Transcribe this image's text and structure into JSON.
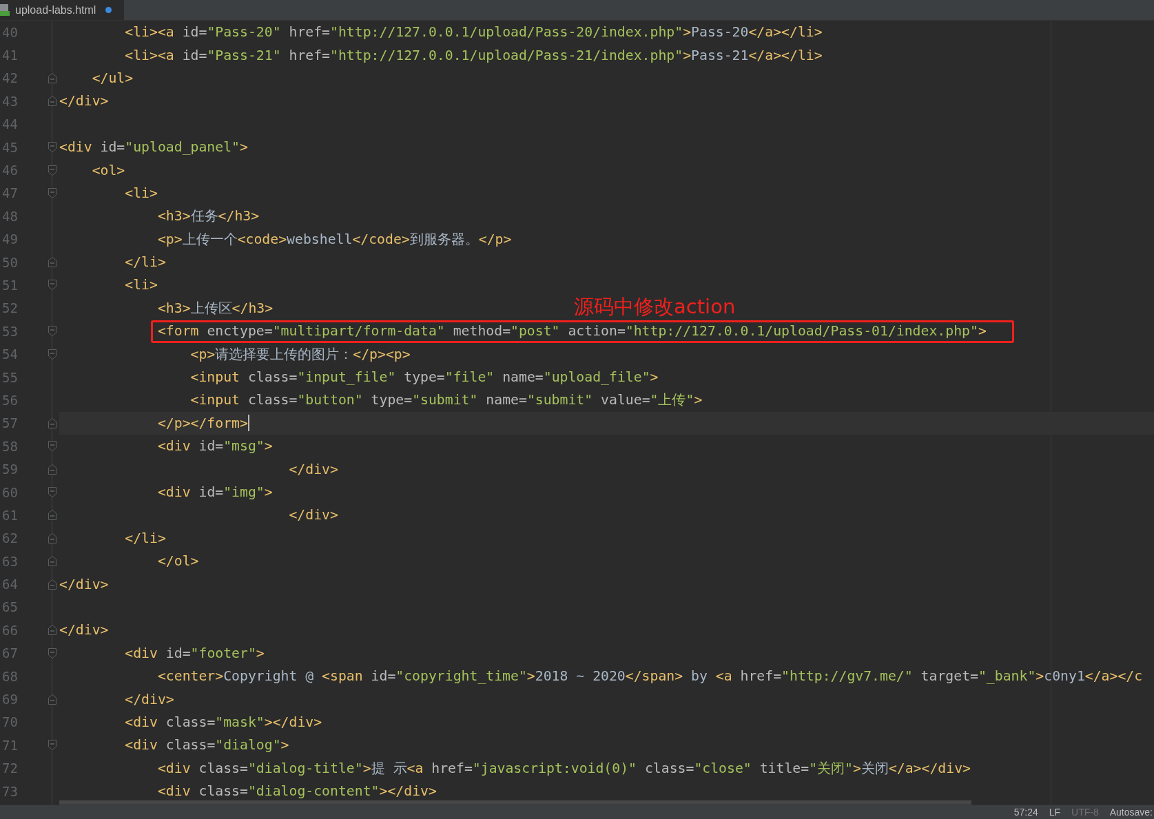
{
  "tab": {
    "label": "upload-labs.html",
    "modified": true,
    "selected": true
  },
  "lines": [
    {
      "number": "40",
      "kind": "plain",
      "segments": [
        {
          "kind": "tag",
          "text": "        <li><a"
        },
        {
          "kind": "attr",
          "text": " id="
        },
        {
          "kind": "value",
          "text": "\"Pass-20\""
        },
        {
          "kind": "attr",
          "text": " href="
        },
        {
          "kind": "value",
          "text": "\"http://127.0.0.1/upload/Pass-20/index.php\""
        },
        {
          "kind": "tag",
          "text": ">"
        },
        {
          "kind": "text",
          "text": "Pass-20"
        },
        {
          "kind": "tag",
          "text": "</a></li>"
        }
      ]
    },
    {
      "number": "41",
      "kind": "plain",
      "segments": [
        {
          "kind": "tag",
          "text": "        <li><a"
        },
        {
          "kind": "attr",
          "text": " id="
        },
        {
          "kind": "value",
          "text": "\"Pass-21\""
        },
        {
          "kind": "attr",
          "text": " href="
        },
        {
          "kind": "value",
          "text": "\"http://127.0.0.1/upload/Pass-21/index.php\""
        },
        {
          "kind": "tag",
          "text": ">"
        },
        {
          "kind": "text",
          "text": "Pass-21"
        },
        {
          "kind": "tag",
          "text": "</a></li>"
        }
      ]
    },
    {
      "number": "42",
      "kind": "fold-end",
      "segments": [
        {
          "kind": "tag",
          "text": "    </ul>"
        }
      ]
    },
    {
      "number": "43",
      "kind": "fold-end",
      "segments": [
        {
          "kind": "tag",
          "text": "</div>"
        }
      ]
    },
    {
      "number": "44",
      "kind": "plain"
    },
    {
      "number": "45",
      "kind": "fold-start",
      "segments": [
        {
          "kind": "tag",
          "text": "<div"
        },
        {
          "kind": "attr",
          "text": " id="
        },
        {
          "kind": "value",
          "text": "\"upload_panel\""
        },
        {
          "kind": "tag",
          "text": ">"
        }
      ]
    },
    {
      "number": "46",
      "kind": "fold-start",
      "segments": [
        {
          "kind": "tag",
          "text": "    <ol>"
        }
      ]
    },
    {
      "number": "47",
      "kind": "fold-start",
      "segments": [
        {
          "kind": "tag",
          "text": "        <li>"
        }
      ]
    },
    {
      "number": "48",
      "kind": "plain",
      "segments": [
        {
          "kind": "tag",
          "text": "            <h3>"
        },
        {
          "kind": "text",
          "text": "任务"
        },
        {
          "kind": "tag",
          "text": "</h3>"
        }
      ]
    },
    {
      "number": "49",
      "kind": "plain",
      "segments": [
        {
          "kind": "tag",
          "text": "            <p>"
        },
        {
          "kind": "text",
          "text": "上传一个"
        },
        {
          "kind": "tag",
          "text": "<code>"
        },
        {
          "kind": "text",
          "text": "webshell"
        },
        {
          "kind": "tag",
          "text": "</code>"
        },
        {
          "kind": "text",
          "text": "到服务器。"
        },
        {
          "kind": "tag",
          "text": "</p>"
        }
      ]
    },
    {
      "number": "50",
      "kind": "fold-end",
      "segments": [
        {
          "kind": "tag",
          "text": "        </li>"
        }
      ]
    },
    {
      "number": "51",
      "kind": "fold-start",
      "segments": [
        {
          "kind": "tag",
          "text": "        <li>"
        }
      ]
    },
    {
      "number": "52",
      "kind": "plain",
      "segments": [
        {
          "kind": "tag",
          "text": "            <h3>"
        },
        {
          "kind": "text",
          "text": "上传区"
        },
        {
          "kind": "tag",
          "text": "</h3>"
        }
      ]
    },
    {
      "number": "53",
      "kind": "fold-start",
      "boxed": true,
      "annotation": "源码中修改action",
      "segments": [
        {
          "kind": "tag",
          "text": "            <form"
        },
        {
          "kind": "attr",
          "text": " enctype="
        },
        {
          "kind": "value",
          "text": "\"multipart/form-data\""
        },
        {
          "kind": "attr",
          "text": " method="
        },
        {
          "kind": "value",
          "text": "\"post\""
        },
        {
          "kind": "attr",
          "text": " action="
        },
        {
          "kind": "value",
          "text": "\"http://127.0.0.1/upload/Pass-01/index.php\""
        },
        {
          "kind": "tag",
          "text": ">"
        }
      ]
    },
    {
      "number": "54",
      "kind": "fold-start",
      "segments": [
        {
          "kind": "tag",
          "text": "                <p>"
        },
        {
          "kind": "text",
          "text": "请选择要上传的图片："
        },
        {
          "kind": "tag",
          "text": "</p><p>"
        }
      ]
    },
    {
      "number": "55",
      "kind": "plain",
      "segments": [
        {
          "kind": "tag",
          "text": "                <input"
        },
        {
          "kind": "attr",
          "text": " class="
        },
        {
          "kind": "value",
          "text": "\"input_file\""
        },
        {
          "kind": "attr",
          "text": " type="
        },
        {
          "kind": "value",
          "text": "\"file\""
        },
        {
          "kind": "attr",
          "text": " name="
        },
        {
          "kind": "value",
          "text": "\"upload_file\""
        },
        {
          "kind": "tag",
          "text": ">"
        }
      ]
    },
    {
      "number": "56",
      "kind": "plain",
      "segments": [
        {
          "kind": "tag",
          "text": "                <input"
        },
        {
          "kind": "attr",
          "text": " class="
        },
        {
          "kind": "value",
          "text": "\"button\""
        },
        {
          "kind": "attr",
          "text": " type="
        },
        {
          "kind": "value",
          "text": "\"submit\""
        },
        {
          "kind": "attr",
          "text": " name="
        },
        {
          "kind": "value",
          "text": "\"submit\""
        },
        {
          "kind": "attr",
          "text": " value="
        },
        {
          "kind": "value",
          "text": "\"上传\""
        },
        {
          "kind": "tag",
          "text": ">"
        }
      ]
    },
    {
      "number": "57",
      "kind": "fold-end",
      "selected": true,
      "caret": true,
      "segments": [
        {
          "kind": "tag",
          "text": "            </p></form>"
        }
      ]
    },
    {
      "number": "58",
      "kind": "fold-start",
      "segments": [
        {
          "kind": "tag",
          "text": "            <div"
        },
        {
          "kind": "attr",
          "text": " id="
        },
        {
          "kind": "value",
          "text": "\"msg\""
        },
        {
          "kind": "tag",
          "text": ">"
        }
      ]
    },
    {
      "number": "59",
      "kind": "fold-end",
      "segments": [
        {
          "kind": "tag",
          "text": "                            </div>"
        }
      ]
    },
    {
      "number": "60",
      "kind": "fold-start",
      "segments": [
        {
          "kind": "tag",
          "text": "            <div"
        },
        {
          "kind": "attr",
          "text": " id="
        },
        {
          "kind": "value",
          "text": "\"img\""
        },
        {
          "kind": "tag",
          "text": ">"
        }
      ]
    },
    {
      "number": "61",
      "kind": "fold-end",
      "segments": [
        {
          "kind": "tag",
          "text": "                            </div>"
        }
      ]
    },
    {
      "number": "62",
      "kind": "fold-end",
      "segments": [
        {
          "kind": "tag",
          "text": "        </li>"
        }
      ]
    },
    {
      "number": "63",
      "kind": "fold-end",
      "segments": [
        {
          "kind": "tag",
          "text": "            </ol>"
        }
      ]
    },
    {
      "number": "64",
      "kind": "fold-end",
      "segments": [
        {
          "kind": "tag",
          "text": "</div>"
        }
      ]
    },
    {
      "number": "65",
      "kind": "plain"
    },
    {
      "number": "66",
      "kind": "fold-end",
      "segments": [
        {
          "kind": "tag",
          "text": "</div>"
        }
      ]
    },
    {
      "number": "67",
      "kind": "fold-start",
      "segments": [
        {
          "kind": "tag",
          "text": "        <div"
        },
        {
          "kind": "attr",
          "text": " id="
        },
        {
          "kind": "value",
          "text": "\"footer\""
        },
        {
          "kind": "tag",
          "text": ">"
        }
      ]
    },
    {
      "number": "68",
      "kind": "plain",
      "segments": [
        {
          "kind": "tag",
          "text": "            <center>"
        },
        {
          "kind": "text",
          "text": "Copyright @ "
        },
        {
          "kind": "tag",
          "text": "<span"
        },
        {
          "kind": "attr",
          "text": " id="
        },
        {
          "kind": "value",
          "text": "\"copyright_time\""
        },
        {
          "kind": "tag",
          "text": ">"
        },
        {
          "kind": "text",
          "text": "2018 ~ 2020"
        },
        {
          "kind": "tag",
          "text": "</span>"
        },
        {
          "kind": "text",
          "text": " by "
        },
        {
          "kind": "tag",
          "text": "<a"
        },
        {
          "kind": "attr",
          "text": " href="
        },
        {
          "kind": "value",
          "text": "\"http://gv7.me/\""
        },
        {
          "kind": "attr",
          "text": " target="
        },
        {
          "kind": "value",
          "text": "\"_bank\""
        },
        {
          "kind": "tag",
          "text": ">"
        },
        {
          "kind": "text",
          "text": "c0ny1"
        },
        {
          "kind": "tag",
          "text": "</a></c"
        }
      ]
    },
    {
      "number": "69",
      "kind": "fold-end",
      "segments": [
        {
          "kind": "tag",
          "text": "        </div>"
        }
      ]
    },
    {
      "number": "70",
      "kind": "plain",
      "segments": [
        {
          "kind": "tag",
          "text": "        <div"
        },
        {
          "kind": "attr",
          "text": " class="
        },
        {
          "kind": "value",
          "text": "\"mask\""
        },
        {
          "kind": "tag",
          "text": "></div>"
        }
      ]
    },
    {
      "number": "71",
      "kind": "fold-start",
      "segments": [
        {
          "kind": "tag",
          "text": "        <div"
        },
        {
          "kind": "attr",
          "text": " class="
        },
        {
          "kind": "value",
          "text": "\"dialog\""
        },
        {
          "kind": "tag",
          "text": ">"
        }
      ]
    },
    {
      "number": "72",
      "kind": "plain",
      "segments": [
        {
          "kind": "tag",
          "text": "            <div"
        },
        {
          "kind": "attr",
          "text": " class="
        },
        {
          "kind": "value",
          "text": "\"dialog-title\""
        },
        {
          "kind": "tag",
          "text": ">"
        },
        {
          "kind": "text",
          "text": "提 示"
        },
        {
          "kind": "tag",
          "text": "<a"
        },
        {
          "kind": "attr",
          "text": " href="
        },
        {
          "kind": "value",
          "text": "\"javascript:void(0)\""
        },
        {
          "kind": "attr",
          "text": " class="
        },
        {
          "kind": "value",
          "text": "\"close\""
        },
        {
          "kind": "attr",
          "text": " title="
        },
        {
          "kind": "value",
          "text": "\"关闭\""
        },
        {
          "kind": "tag",
          "text": ">"
        },
        {
          "kind": "text",
          "text": "关闭"
        },
        {
          "kind": "tag",
          "text": "</a></div>"
        }
      ]
    },
    {
      "number": "73",
      "kind": "plain",
      "segments": [
        {
          "kind": "tag",
          "text": "            <div"
        },
        {
          "kind": "attr",
          "text": " class="
        },
        {
          "kind": "value",
          "text": "\"dialog-content\""
        },
        {
          "kind": "tag",
          "text": "></div>"
        }
      ]
    }
  ],
  "status_bar": [
    {
      "text": "57:24",
      "disabled": false
    },
    {
      "text": "LF",
      "disabled": false
    },
    {
      "text": "UTF-8",
      "disabled": true
    },
    {
      "text": "Autosave:",
      "disabled": false
    }
  ]
}
